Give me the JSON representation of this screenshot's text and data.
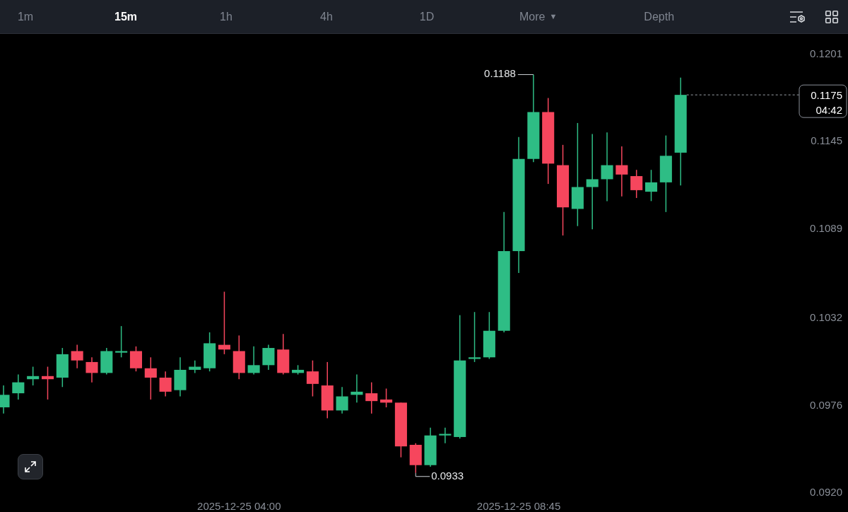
{
  "toolbar": {
    "intervals": [
      {
        "label": "1m",
        "selected": false
      },
      {
        "label": "15m",
        "selected": true
      },
      {
        "label": "1h",
        "selected": false
      },
      {
        "label": "4h",
        "selected": false
      },
      {
        "label": "1D",
        "selected": false
      }
    ],
    "more": {
      "label": "More",
      "caret": "▼"
    },
    "depth": {
      "label": "Depth"
    }
  },
  "chart": {
    "price_axis": [
      "0.1201",
      "0.1145",
      "0.1089",
      "0.1032",
      "0.0976",
      "0.0920"
    ],
    "time_axis": [
      "2025-12-25 04:00",
      "2025-12-25 08:45"
    ],
    "high_label": "0.1188",
    "low_label": "0.0933",
    "last_price": {
      "value": "0.1175",
      "countdown": "04:42"
    }
  }
}
